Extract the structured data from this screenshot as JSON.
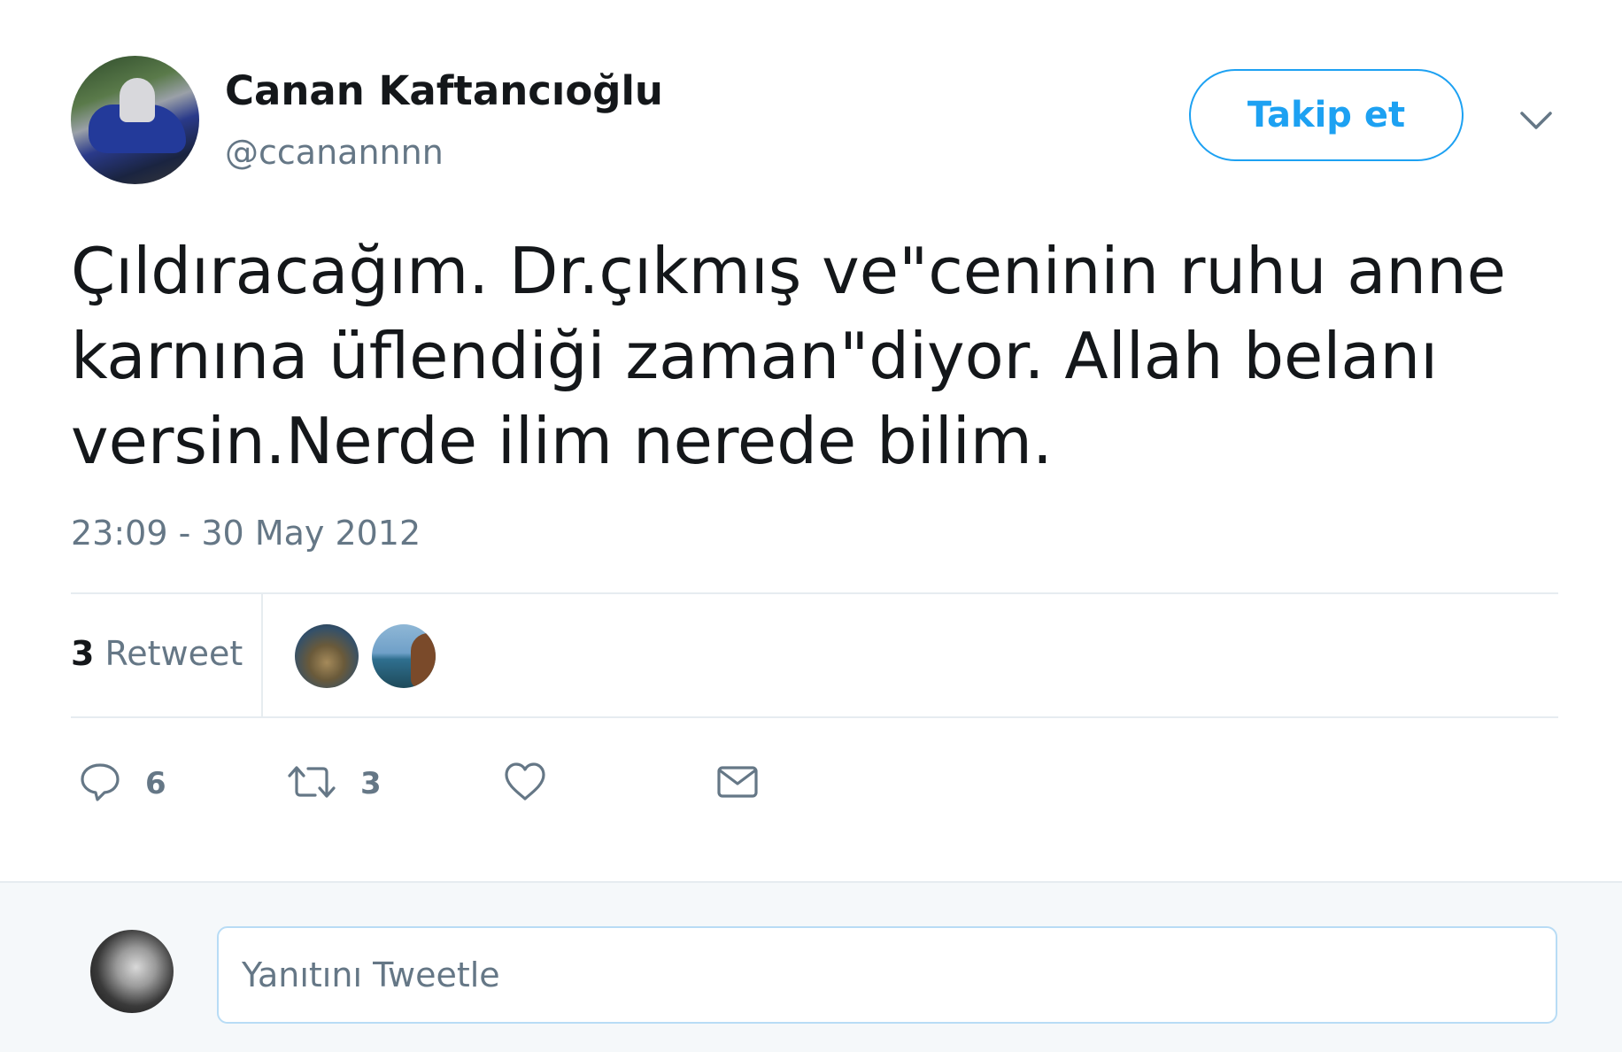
{
  "author": {
    "display_name": "Canan Kaftancıoğlu",
    "handle": "@ccanannnn"
  },
  "follow_button_label": "Takip et",
  "tweet": {
    "text": "Çıldıracağım. Dr.çıkmış ve\"ceninin ruhu anne karnına üflendiği zaman\"diyor. Allah belanı versin.Nerde ilim nerede bilim.",
    "timestamp": "23:09 - 30 May 2012"
  },
  "retweet_stats": {
    "count": "3",
    "label": "Retweet"
  },
  "actions": {
    "reply_count": "6",
    "retweet_count": "3"
  },
  "reply_box": {
    "placeholder": "Yanıtını Tweetle"
  },
  "colors": {
    "accent": "#1da1f2",
    "secondary_text": "#657786",
    "reply_bg": "#f5f8fa"
  },
  "icons": [
    "chevron-down-icon",
    "reply-icon",
    "retweet-icon",
    "heart-icon",
    "mail-icon"
  ]
}
